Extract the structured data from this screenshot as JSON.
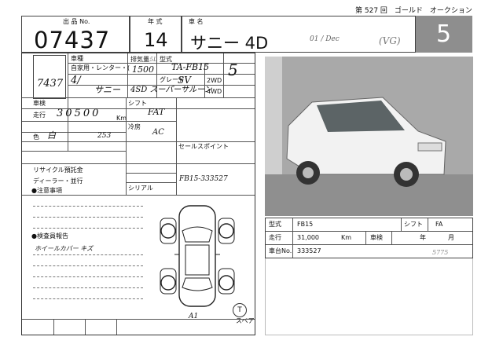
{
  "header": {
    "auction_title": "第 527 回　ゴールド　オークション"
  },
  "top_row": {
    "lot_label": "出 品 No.",
    "lot_number": "07437",
    "year_label": "年 式",
    "year": "14",
    "name_label": "車 名",
    "car_name": "サニー 4D",
    "note_date": "01 / Dec",
    "note_grade": "(VG)",
    "score": "5"
  },
  "sheet": {
    "stamp_number": "7437",
    "fields": {
      "type_label": "車種",
      "use_label": "自家用・レンター・(",
      "displacement_label": "排気量",
      "displacement": "1500",
      "displacement_top": "1.5L",
      "model_label": "型式",
      "model_value": "TA-FB15",
      "grade_label": "グレード",
      "grade_value": "SV",
      "drive_2wd": "2WD",
      "drive_4wd": "4WD",
      "doors": "4/",
      "car_handwritten": "サニー",
      "grade_handwritten": "4SD スーパーサルーン",
      "body_label": "車検",
      "mileage_label": "走行",
      "mileage_value": "30500",
      "mileage_unit": "Km",
      "color_label": "色",
      "color_value": "白",
      "color_code_value": "253",
      "shift_label": "シフト",
      "shift_value": "FAT",
      "ac_label": "冷房",
      "ac_value": "AC",
      "score_hand": "5",
      "sales_point_label": "セールスポイント",
      "recycle_label": "リサイクル預託金",
      "dealer_label": "ディーラー・並行",
      "serial_label": "シリアル",
      "serial_value": "FB15-333527",
      "notes_label": "●注意事項",
      "inspection_label": "●検査員報告",
      "inspection_value": "ホイールカバー キズ",
      "diagram_mark_a": "A1",
      "diagram_mark_t": "T",
      "diagram_mark_spare": "スペア"
    }
  },
  "photo": {
    "description_alt": "car photo"
  },
  "info_table": {
    "model_label": "型式",
    "model_value": "FB15",
    "shift_label": "シフト",
    "shift_value": "FA",
    "mileage_label": "走行",
    "mileage_value": "31,000",
    "mileage_unit": "Km",
    "inspection_label": "車検",
    "inspection_year": "年",
    "inspection_month": "月",
    "chassis_label": "車台No.",
    "chassis_value": "333527",
    "chassis_note": "5775"
  }
}
